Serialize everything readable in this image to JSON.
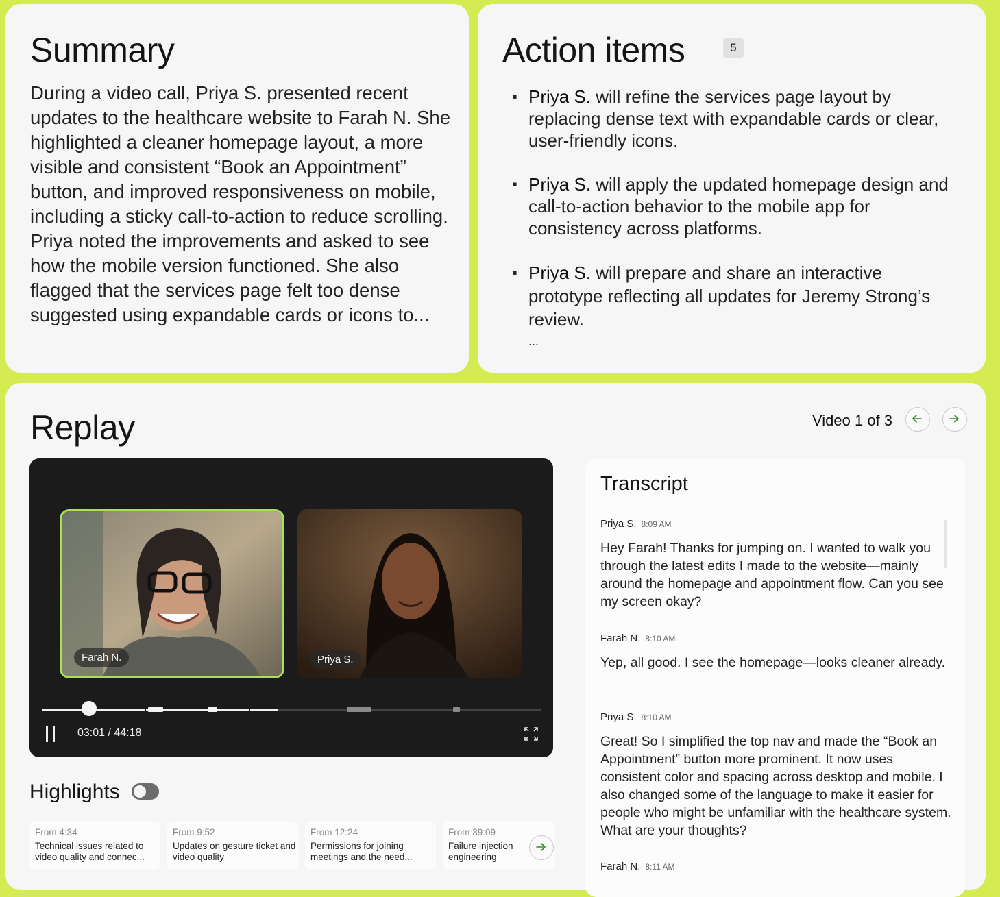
{
  "summary": {
    "title": "Summary",
    "text": "During a video call, Priya S. presented recent updates to the healthcare website to Farah N. She highlighted a cleaner homepage layout, a more visible and consistent “Book an Appointment” button, and improved responsiveness on mobile, including a sticky call-to-action to reduce scrolling. Priya noted the improvements and asked to see how the mobile version functioned. She also flagged that the services page felt too dense suggested using expandable cards or icons to..."
  },
  "action_items": {
    "title": "Action items",
    "count": "5",
    "items": [
      {
        "name": "Priya S.",
        "text": " will refine the services page layout by replacing dense text with expandable cards or clear, user-friendly icons."
      },
      {
        "name": "Priya S.",
        "text": " will apply the updated homepage design and call-to-action behavior to the mobile app for consistency across platforms."
      },
      {
        "name": "Priya S.",
        "text": " will prepare and share an interactive prototype reflecting all updates for Jeremy Strong’s review."
      }
    ],
    "more": "..."
  },
  "replay": {
    "title": "Replay",
    "video_counter": "Video 1 of 3",
    "participants": [
      "Farah N.",
      "Priya S."
    ],
    "time_display": "03:01 / 44:18",
    "progress": 0.095
  },
  "highlights": {
    "title": "Highlights",
    "enabled": false,
    "items": [
      {
        "from": "From 4:34",
        "desc": "Technical issues related to video quality and connec..."
      },
      {
        "from": "From 9:52",
        "desc": "Updates on gesture ticket and video quality"
      },
      {
        "from": "From 12:24",
        "desc": "Permissions for joining meetings and the need..."
      },
      {
        "from": "From 39:09",
        "desc": "Failure injection engineering"
      }
    ]
  },
  "transcript": {
    "title": "Transcript",
    "messages": [
      {
        "speaker": "Priya S.",
        "time": "8:09 AM",
        "text": "Hey Farah! Thanks for jumping on. I wanted to walk you through the latest edits I made to the website—mainly around the homepage and appointment flow. Can you see my screen okay?"
      },
      {
        "speaker": "Farah N.",
        "time": "8:10 AM",
        "text": "Yep, all good. I see the homepage—looks cleaner already."
      },
      {
        "speaker": "Priya S.",
        "time": "8:10 AM",
        "text": "Great! So I simplified the top nav and made the “Book an Appointment” button more prominent. It now uses consistent color and spacing across desktop and mobile. I also changed some of the language to make it easier for people who might be unfamiliar with the healthcare system. What are your thoughts?"
      },
      {
        "speaker": "Farah N.",
        "time": "8:11 AM",
        "text": ""
      }
    ]
  },
  "colors": {
    "background": "#d4ec52",
    "card": "#f6f6f6",
    "player": "#1b1b1b",
    "active_speaker": "#a8e05a",
    "arrow_accent": "#3a8a2a"
  }
}
